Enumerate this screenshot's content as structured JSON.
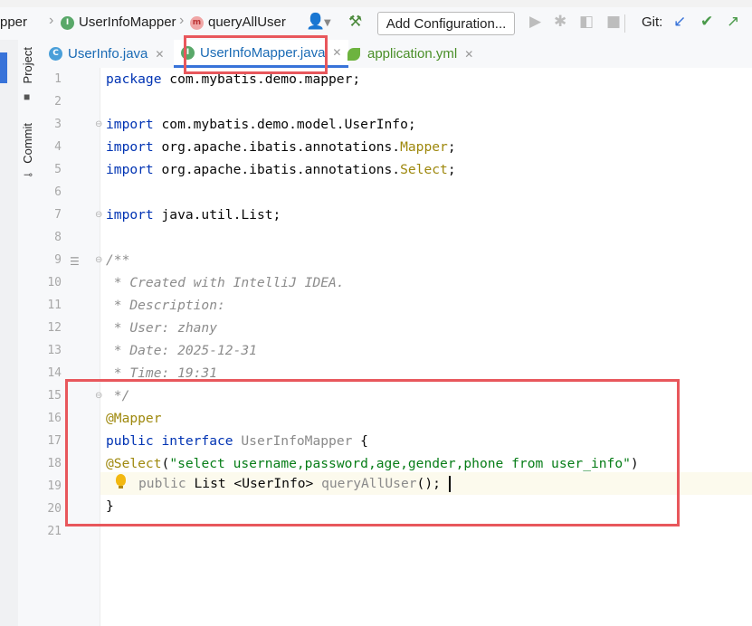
{
  "breadcrumb": {
    "items": [
      {
        "label": "pper",
        "icon": null
      },
      {
        "label": "UserInfoMapper",
        "icon": "interface-icon",
        "badge": "I"
      },
      {
        "label": "queryAllUser",
        "icon": "method-icon",
        "badge": "m"
      }
    ]
  },
  "toolbar": {
    "add_configuration_label": "Add Configuration...",
    "git_label": "Git:"
  },
  "sidebar": {
    "project_label": "Project",
    "commit_label": "Commit"
  },
  "tabs": [
    {
      "label": "UserInfo.java",
      "badge": "C",
      "active": false
    },
    {
      "label": "UserInfoMapper.java",
      "badge": "I",
      "active": true
    },
    {
      "label": "application.yml",
      "badge": "",
      "active": false
    }
  ],
  "editor": {
    "line_numbers": [
      "1",
      "2",
      "3",
      "4",
      "5",
      "6",
      "7",
      "8",
      "9",
      "10",
      "11",
      "12",
      "13",
      "14",
      "15",
      "16",
      "17",
      "18",
      "19",
      "20",
      "21"
    ],
    "lines": {
      "l1_kw": "package",
      "l1_rest": " com.mybatis.demo.mapper;",
      "l3_kw": "import",
      "l3_rest": " com.mybatis.demo.model.UserInfo;",
      "l4_kw": "import",
      "l4_rest": " org.apache.ibatis.annotations.",
      "l4_ann": "Mapper",
      "l4_end": ";",
      "l5_kw": "import",
      "l5_rest": " org.apache.ibatis.annotations.",
      "l5_ann": "Select",
      "l5_end": ";",
      "l7_kw": "import",
      "l7_rest": " java.util.List;",
      "l9": "/**",
      "l10": " * Created with IntelliJ IDEA.",
      "l11": " * Description:",
      "l12": " * User: zhany",
      "l13": " * Date: 2025-12-31",
      "l14": " * Time: 19:31",
      "l15": " */",
      "l16": "@Mapper",
      "l17_kw": "public interface",
      "l17_name": " UserInfoMapper",
      "l17_end": " {",
      "l18_ann": "@Select",
      "l18_open": "(",
      "l18_str": "\"select username,password,age,gender,phone from user_info\"",
      "l18_close": ")",
      "l19_kw": "public",
      "l19_type": " List <UserInfo> ",
      "l19_meth": "queryAllUser",
      "l19_end": "();",
      "l20": "}"
    }
  },
  "colors": {
    "keyword": "#0033b3",
    "annotation": "#9e880d",
    "string": "#067d17",
    "comment": "#8c8c8c",
    "highlight_box": "#e8575c",
    "accent": "#3873d9"
  }
}
